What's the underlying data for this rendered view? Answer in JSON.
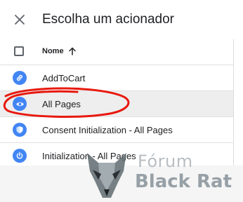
{
  "header": {
    "title": "Escolha um acionador"
  },
  "table": {
    "column_name_label": "Nome",
    "rows": [
      {
        "label": "AddToCart",
        "icon": "link-icon",
        "color": "#4285f4"
      },
      {
        "label": "All Pages",
        "icon": "eye-icon",
        "color": "#4285f4"
      },
      {
        "label": "Consent Initialization - All Pages",
        "icon": "shield-icon",
        "color": "#4285f4"
      },
      {
        "label": "Initialization - All Pages",
        "icon": "power-icon",
        "color": "#4285f4"
      }
    ]
  },
  "annotation": {
    "color": "#e8190e"
  },
  "watermark": {
    "line1": "Fórum",
    "line2": "Black Rat"
  }
}
